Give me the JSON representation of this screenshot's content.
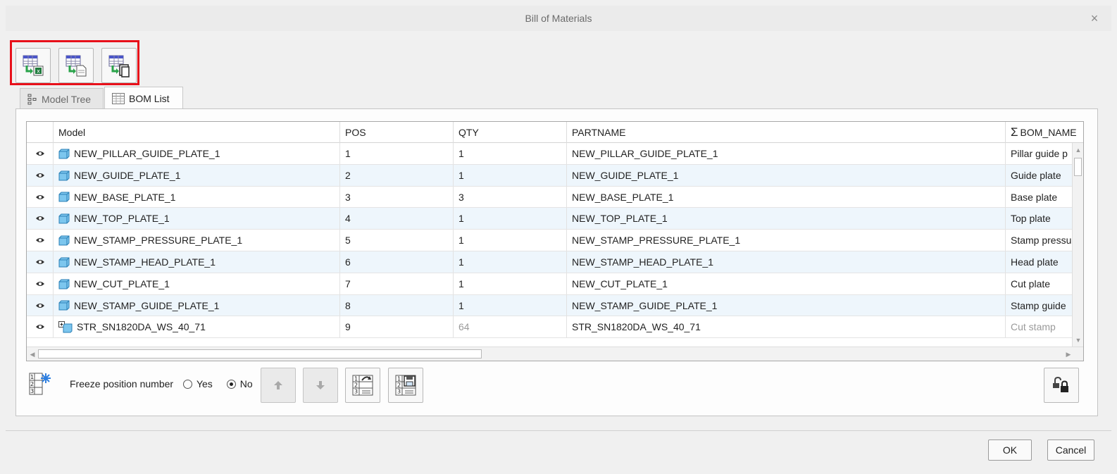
{
  "window": {
    "title": "Bill of Materials",
    "close_glyph": "×"
  },
  "toolbar": {
    "buttons": [
      {
        "icon": "export-excel-icon"
      },
      {
        "icon": "export-text-icon"
      },
      {
        "icon": "export-copy-icon"
      }
    ]
  },
  "tabs": [
    {
      "label": "Model Tree",
      "icon": "model-tree-icon",
      "active": false
    },
    {
      "label": "BOM List",
      "icon": "table-icon",
      "active": true
    }
  ],
  "table": {
    "columns": [
      {
        "label": ""
      },
      {
        "label": "Model"
      },
      {
        "label": "POS"
      },
      {
        "label": "QTY"
      },
      {
        "label": "PARTNAME"
      },
      {
        "label": "BOM_NAME",
        "prefix": "Σ"
      }
    ],
    "rows": [
      {
        "model": "NEW_PILLAR_GUIDE_PLATE_1",
        "pos": "1",
        "qty": "1",
        "partname": "NEW_PILLAR_GUIDE_PLATE_1",
        "bom_name": "Pillar guide p"
      },
      {
        "model": "NEW_GUIDE_PLATE_1",
        "pos": "2",
        "qty": "1",
        "partname": "NEW_GUIDE_PLATE_1",
        "bom_name": "Guide plate"
      },
      {
        "model": "NEW_BASE_PLATE_1",
        "pos": "3",
        "qty": "3",
        "partname": "NEW_BASE_PLATE_1",
        "bom_name": "Base plate"
      },
      {
        "model": "NEW_TOP_PLATE_1",
        "pos": "4",
        "qty": "1",
        "partname": "NEW_TOP_PLATE_1",
        "bom_name": "Top plate"
      },
      {
        "model": "NEW_STAMP_PRESSURE_PLATE_1",
        "pos": "5",
        "qty": "1",
        "partname": "NEW_STAMP_PRESSURE_PLATE_1",
        "bom_name": "Stamp pressu"
      },
      {
        "model": "NEW_STAMP_HEAD_PLATE_1",
        "pos": "6",
        "qty": "1",
        "partname": "NEW_STAMP_HEAD_PLATE_1",
        "bom_name": "Head plate"
      },
      {
        "model": "NEW_CUT_PLATE_1",
        "pos": "7",
        "qty": "1",
        "partname": "NEW_CUT_PLATE_1",
        "bom_name": "Cut plate"
      },
      {
        "model": "NEW_STAMP_GUIDE_PLATE_1",
        "pos": "8",
        "qty": "1",
        "partname": "NEW_STAMP_GUIDE_PLATE_1",
        "bom_name": "Stamp guide"
      },
      {
        "model": "STR_SN1820DA_WS_40_71",
        "pos": "9",
        "qty": "64",
        "partname": "STR_SN1820DA_WS_40_71",
        "bom_name": "Cut stamp",
        "assembly": true
      }
    ]
  },
  "freeze": {
    "label": "Freeze position number",
    "yes_label": "Yes",
    "no_label": "No",
    "selected": "No"
  },
  "footer": {
    "ok_label": "OK",
    "cancel_label": "Cancel"
  },
  "colors": {
    "highlight_frame": "#e8101a",
    "row_alt": "#eef6fc",
    "part_icon": "#5fb6e4",
    "export_green": "#2aa34a"
  }
}
